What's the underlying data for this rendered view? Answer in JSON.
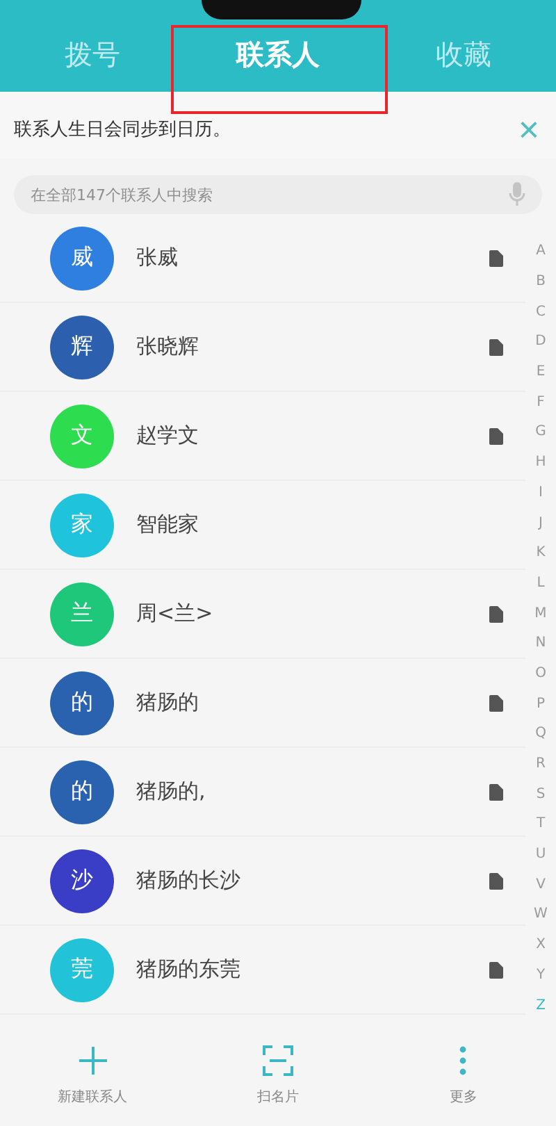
{
  "tabs": [
    {
      "label": "拨号",
      "selected": false
    },
    {
      "label": "联系人",
      "selected": true
    },
    {
      "label": "收藏",
      "selected": false
    }
  ],
  "banner": {
    "text": "联系人生日会同步到日历。",
    "close": "×"
  },
  "search": {
    "placeholder": "在全部147个联系人中搜索"
  },
  "contacts": [
    {
      "avatar": "威",
      "name": "张威",
      "color": "#2f7fe0",
      "sim": true
    },
    {
      "avatar": "辉",
      "name": "张晓辉",
      "color": "#2c5fae",
      "sim": true
    },
    {
      "avatar": "文",
      "name": "赵学文",
      "color": "#2ddc4f",
      "sim": true
    },
    {
      "avatar": "家",
      "name": "智能家",
      "color": "#1fc4dc",
      "sim": false
    },
    {
      "avatar": "兰",
      "name": "周<兰>",
      "color": "#1fc77a",
      "sim": true
    },
    {
      "avatar": "的",
      "name": "猪肠的",
      "color": "#2a62b0",
      "sim": true
    },
    {
      "avatar": "的",
      "name": "猪肠的,",
      "color": "#2a62b0",
      "sim": true
    },
    {
      "avatar": "沙",
      "name": "猪肠的长沙",
      "color": "#3a3ec6",
      "sim": true
    },
    {
      "avatar": "莞",
      "name": "猪肠的东莞",
      "color": "#22c3d8",
      "sim": true
    }
  ],
  "index": [
    {
      "letter": "A",
      "selected": false
    },
    {
      "letter": "B",
      "selected": false
    },
    {
      "letter": "C",
      "selected": false
    },
    {
      "letter": "D",
      "selected": false
    },
    {
      "letter": "E",
      "selected": false
    },
    {
      "letter": "F",
      "selected": false
    },
    {
      "letter": "G",
      "selected": false
    },
    {
      "letter": "H",
      "selected": false
    },
    {
      "letter": "I",
      "selected": false
    },
    {
      "letter": "J",
      "selected": false
    },
    {
      "letter": "K",
      "selected": false
    },
    {
      "letter": "L",
      "selected": false
    },
    {
      "letter": "M",
      "selected": false
    },
    {
      "letter": "N",
      "selected": false
    },
    {
      "letter": "O",
      "selected": false
    },
    {
      "letter": "P",
      "selected": false
    },
    {
      "letter": "Q",
      "selected": false
    },
    {
      "letter": "R",
      "selected": false
    },
    {
      "letter": "S",
      "selected": false
    },
    {
      "letter": "T",
      "selected": false
    },
    {
      "letter": "U",
      "selected": false
    },
    {
      "letter": "V",
      "selected": false
    },
    {
      "letter": "W",
      "selected": false
    },
    {
      "letter": "X",
      "selected": false
    },
    {
      "letter": "Y",
      "selected": false
    },
    {
      "letter": "Z",
      "selected": true
    }
  ],
  "toolbar": [
    {
      "kind": "add",
      "label": "新建联系人"
    },
    {
      "kind": "scan",
      "label": "扫名片"
    },
    {
      "kind": "more",
      "label": "更多"
    }
  ]
}
